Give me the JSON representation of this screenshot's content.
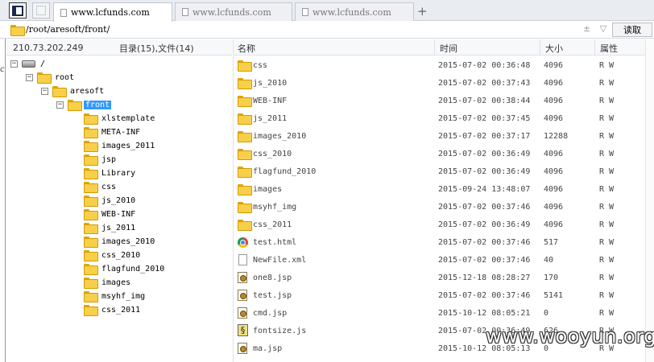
{
  "tabs": [
    {
      "label": "www.lcfunds.com",
      "active": true
    },
    {
      "label": "www.lcfunds.com",
      "active": false
    },
    {
      "label": "www.lcfunds.com",
      "active": false
    }
  ],
  "new_tab_label": "+",
  "address": {
    "path": "/root/aresoft/front/",
    "controls": "± ▽",
    "read_button": "读取"
  },
  "left_edge_char": "c",
  "tree_panel": {
    "ip": "210.73.202.249",
    "count": "目录(15),文件(14)",
    "expander_expanded": "−",
    "nodes": [
      {
        "label": "/",
        "icon": "drive-icon",
        "expander": true
      },
      {
        "label": "root",
        "icon": "folder-icon",
        "expander": true
      },
      {
        "label": "aresoft",
        "icon": "folder-icon",
        "expander": true
      },
      {
        "label": "front",
        "icon": "folder-icon",
        "expander": true,
        "selected": true
      },
      {
        "label": "xlstemplate",
        "icon": "folder-icon"
      },
      {
        "label": "META-INF",
        "icon": "folder-icon"
      },
      {
        "label": "images_2011",
        "icon": "folder-icon"
      },
      {
        "label": "jsp",
        "icon": "folder-icon"
      },
      {
        "label": "Library",
        "icon": "folder-icon"
      },
      {
        "label": "css",
        "icon": "folder-icon"
      },
      {
        "label": "js_2010",
        "icon": "folder-icon"
      },
      {
        "label": "WEB-INF",
        "icon": "folder-icon"
      },
      {
        "label": "js_2011",
        "icon": "folder-icon"
      },
      {
        "label": "images_2010",
        "icon": "folder-icon"
      },
      {
        "label": "css_2010",
        "icon": "folder-icon"
      },
      {
        "label": "flagfund_2010",
        "icon": "folder-icon"
      },
      {
        "label": "images",
        "icon": "folder-icon"
      },
      {
        "label": "msyhf_img",
        "icon": "folder-icon"
      },
      {
        "label": "css_2011",
        "icon": "folder-icon"
      }
    ]
  },
  "file_list": {
    "columns": {
      "name": "名称",
      "time": "时间",
      "size": "大小",
      "attr": "属性"
    },
    "rows": [
      {
        "name": "css",
        "time": "2015-07-02 00:36:48",
        "size": "4096",
        "attr": "R W",
        "icon": "folder-icon"
      },
      {
        "name": "js_2010",
        "time": "2015-07-02 00:37:43",
        "size": "4096",
        "attr": "R W",
        "icon": "folder-icon"
      },
      {
        "name": "WEB-INF",
        "time": "2015-07-02 00:38:44",
        "size": "4096",
        "attr": "R W",
        "icon": "folder-icon"
      },
      {
        "name": "js_2011",
        "time": "2015-07-02 00:37:45",
        "size": "4096",
        "attr": "R W",
        "icon": "folder-icon"
      },
      {
        "name": "images_2010",
        "time": "2015-07-02 00:37:17",
        "size": "12288",
        "attr": "R W",
        "icon": "folder-icon"
      },
      {
        "name": "css_2010",
        "time": "2015-07-02 00:36:49",
        "size": "4096",
        "attr": "R W",
        "icon": "folder-icon"
      },
      {
        "name": "flagfund_2010",
        "time": "2015-07-02 00:36:49",
        "size": "4096",
        "attr": "R W",
        "icon": "folder-icon"
      },
      {
        "name": "images",
        "time": "2015-09-24 13:48:07",
        "size": "4096",
        "attr": "R W",
        "icon": "folder-icon"
      },
      {
        "name": "msyhf_img",
        "time": "2015-07-02 00:37:46",
        "size": "4096",
        "attr": "R W",
        "icon": "folder-icon"
      },
      {
        "name": "css_2011",
        "time": "2015-07-02 00:36:49",
        "size": "4096",
        "attr": "R W",
        "icon": "folder-icon"
      },
      {
        "name": "test.html",
        "time": "2015-07-02 00:37:46",
        "size": "517",
        "attr": "R W",
        "icon": "chrome-icon"
      },
      {
        "name": "NewFile.xml",
        "time": "2015-07-02 00:37:46",
        "size": "40",
        "attr": "R W",
        "icon": "document-icon"
      },
      {
        "name": "one8.jsp",
        "time": "2015-12-18 08:28:27",
        "size": "170",
        "attr": "R W",
        "icon": "jsp-file-icon"
      },
      {
        "name": "test.jsp",
        "time": "2015-07-02 00:37:46",
        "size": "5141",
        "attr": "R W",
        "icon": "jsp-file-icon"
      },
      {
        "name": "cmd.jsp",
        "time": "2015-10-12 08:05:21",
        "size": "0",
        "attr": "R W",
        "icon": "jsp-file-icon"
      },
      {
        "name": "fontsize.js",
        "time": "2015-07-02 00:36:49",
        "size": "626",
        "attr": "R W",
        "icon": "js-file-icon"
      },
      {
        "name": "ma.jsp",
        "time": "2015-10-12 08:05:13",
        "size": "0",
        "attr": "R W",
        "icon": "jsp-file-icon"
      }
    ]
  },
  "js_icon_glyph": "§",
  "watermark": "www.wooyun.org"
}
